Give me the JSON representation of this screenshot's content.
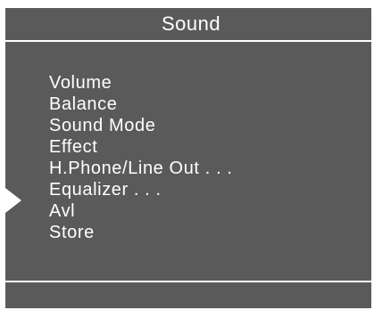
{
  "header": {
    "title": "Sound"
  },
  "menu": {
    "items": [
      {
        "label": "Volume"
      },
      {
        "label": "Balance"
      },
      {
        "label": "Sound Mode"
      },
      {
        "label": "Effect"
      },
      {
        "label": "H.Phone/Line Out . . ."
      },
      {
        "label": "Equalizer . . ."
      },
      {
        "label": "Avl"
      },
      {
        "label": "Store"
      }
    ],
    "selected_label": "Equalizer . . .",
    "pointer_icon": "triangle-right-icon"
  },
  "colors": {
    "panel_bg": "#5a5a5a",
    "text": "#ffffff",
    "border": "#ffffff",
    "page_bg": "#ffffff"
  }
}
